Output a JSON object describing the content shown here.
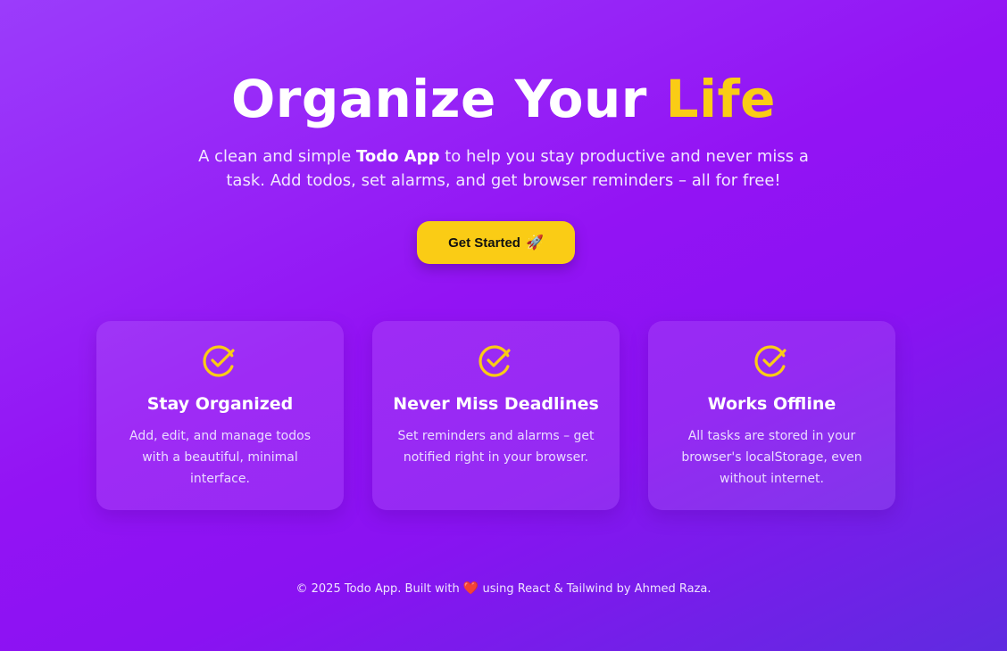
{
  "hero": {
    "title_main": "Organize Your",
    "title_accent": "Life",
    "subtitle_pre": "A clean and simple ",
    "subtitle_bold": "Todo App",
    "subtitle_post": " to help you stay productive and never miss a task. Add todos, set alarms, and get browser reminders – all for free!",
    "cta_label": "Get Started",
    "cta_icon": "🚀"
  },
  "features": [
    {
      "icon": "check-circle-icon",
      "title": "Stay Organized",
      "description": "Add, edit, and manage todos with a beautiful, minimal interface."
    },
    {
      "icon": "check-circle-icon",
      "title": "Never Miss Deadlines",
      "description": "Set reminders and alarms – get notified right in your browser."
    },
    {
      "icon": "check-circle-icon",
      "title": "Works Offline",
      "description": "All tasks are stored in your browser's localStorage, even without internet."
    }
  ],
  "footer": {
    "text_pre": "© 2025 Todo App. Built with",
    "heart": "❤️",
    "text_post": "using React & Tailwind by Ahmed Raza."
  },
  "colors": {
    "accent": "#facc15",
    "background_start": "#9b3cfb",
    "background_end": "#5f2be0"
  }
}
